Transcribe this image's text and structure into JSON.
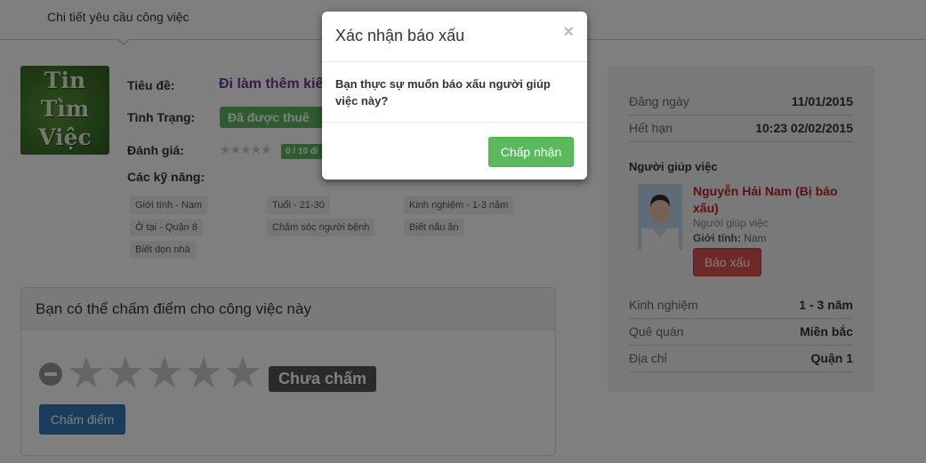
{
  "header": {
    "tab_label": "Chi tiết yêu cầu công việc"
  },
  "logo": {
    "lines": [
      "Tin",
      "Tìm",
      "Việc"
    ]
  },
  "job": {
    "title_label": "Tiêu đề:",
    "title_value": "Đi làm thêm kiế",
    "status_label": "Tình Trạng:",
    "status_value": "Đã được thuê",
    "rating_label": "Đánh giá:",
    "rating_stars": "★★★★★",
    "rating_score": "0 / 10 đi",
    "skills_label": "Các kỹ năng:",
    "skills": [
      "Giới tính - Nam",
      "Tuổi - 21-30",
      "Kinh nghiệm - 1-3 năm",
      "Ở tại - Quận 8",
      "Chăm sóc người bệnh",
      "Biết nấu ăn",
      "Biết dọn nhà"
    ]
  },
  "rate_panel": {
    "title": "Bạn có thể chấm điểm cho công việc này",
    "status": "Chưa chấm",
    "button": "Chấm điểm",
    "stars": "★"
  },
  "info": {
    "posted_label": "Đăng ngày",
    "posted_value": "11/01/2015",
    "expires_label": "Hết hạn",
    "expires_value": "10:23 02/02/2015",
    "helper_title": "Người giúp việc",
    "helper_name": "Nguyễn Hải Nam (Bị báo xấu)",
    "helper_role": "Người giúp việc",
    "helper_gender_label": "Giới tính:",
    "helper_gender_value": "Nam",
    "report_button": "Báo xấu",
    "experience_label": "Kinh nghiệm",
    "experience_value": "1 - 3 năm",
    "hometown_label": "Quê quán",
    "hometown_value": "Miền bắc",
    "address_label": "Địa chỉ",
    "address_value": "Quận 1"
  },
  "modal": {
    "title": "Xác nhận báo xấu",
    "close": "×",
    "body": "Bạn thực sự muốn báo xấu người giúp việc này?",
    "confirm_button": "Chấp nhận"
  }
}
